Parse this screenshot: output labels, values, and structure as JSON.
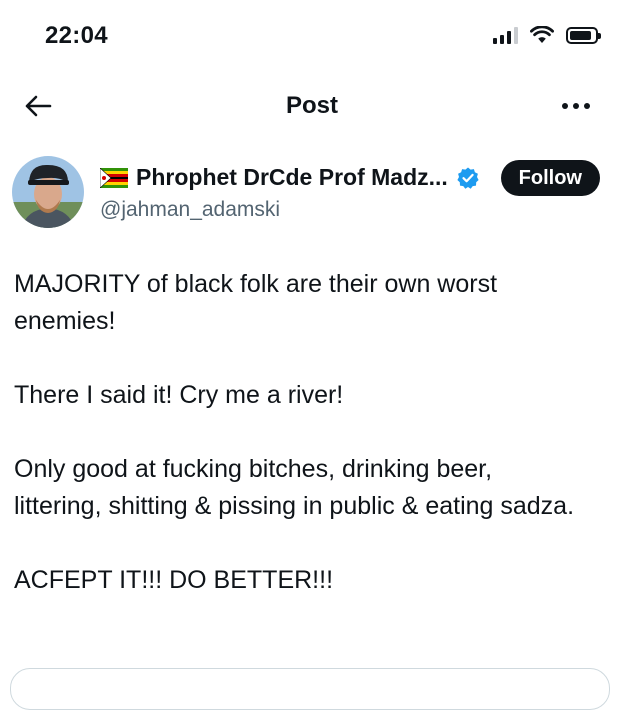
{
  "status_bar": {
    "time": "22:04",
    "icons": [
      "cellular-signal-icon",
      "wifi-icon",
      "battery-icon"
    ]
  },
  "nav": {
    "back_icon": "back-arrow-icon",
    "title": "Post",
    "more_icon": "more-horizontal-icon"
  },
  "author": {
    "flag_icon": "zimbabwe-flag-icon",
    "display_name": "Phrophet DrCde Prof Madz...",
    "verified_icon": "verified-badge-icon",
    "handle": "@jahman_adamski",
    "follow_label": "Follow"
  },
  "post": {
    "paragraphs": [
      "MAJORITY of black folk are their own worst enemies!",
      "There I said it! Cry me a river!",
      "Only good at fucking bitches, drinking beer, littering, shitting & pissing in public & eating sadza.",
      "ACFEPT IT!!! DO BETTER!!!"
    ]
  },
  "colors": {
    "text": "#0f1419",
    "secondary": "#536471",
    "verified": "#1d9bf0",
    "follow_bg": "#0f1419",
    "follow_text": "#ffffff"
  }
}
